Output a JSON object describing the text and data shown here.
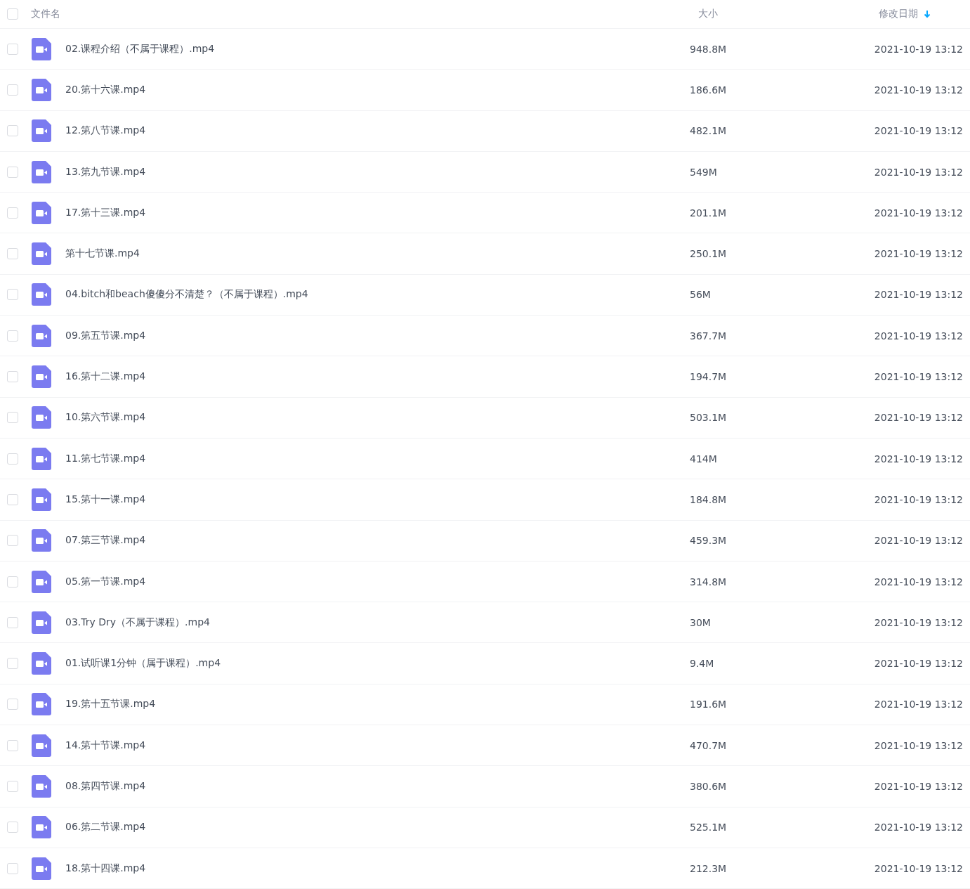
{
  "header": {
    "checked": false,
    "columns": [
      {
        "label": "文件名",
        "sorted": false
      },
      {
        "label": "大小",
        "sorted": false
      },
      {
        "label": "修改日期",
        "sorted": true
      }
    ]
  },
  "rows": [
    {
      "kind": "video",
      "checked": false,
      "name": "02.课程介绍（不属于课程）.mp4",
      "size": "948.8M",
      "modified": "2021-10-19 13:12"
    },
    {
      "kind": "video",
      "checked": false,
      "name": "20.第十六课.mp4",
      "size": "186.6M",
      "modified": "2021-10-19 13:12"
    },
    {
      "kind": "video",
      "checked": false,
      "name": "12.第八节课.mp4",
      "size": "482.1M",
      "modified": "2021-10-19 13:12"
    },
    {
      "kind": "video",
      "checked": false,
      "name": "13.第九节课.mp4",
      "size": "549M",
      "modified": "2021-10-19 13:12"
    },
    {
      "kind": "video",
      "checked": false,
      "name": "17.第十三课.mp4",
      "size": "201.1M",
      "modified": "2021-10-19 13:12"
    },
    {
      "kind": "video",
      "checked": false,
      "name": "第十七节课.mp4",
      "size": "250.1M",
      "modified": "2021-10-19 13:12"
    },
    {
      "kind": "video",
      "checked": false,
      "name": "04.bitch和beach傻傻分不清楚？（不属于课程）.mp4",
      "size": "56M",
      "modified": "2021-10-19 13:12"
    },
    {
      "kind": "video",
      "checked": false,
      "name": "09.第五节课.mp4",
      "size": "367.7M",
      "modified": "2021-10-19 13:12"
    },
    {
      "kind": "video",
      "checked": false,
      "name": "16.第十二课.mp4",
      "size": "194.7M",
      "modified": "2021-10-19 13:12"
    },
    {
      "kind": "video",
      "checked": false,
      "name": "10.第六节课.mp4",
      "size": "503.1M",
      "modified": "2021-10-19 13:12"
    },
    {
      "kind": "video",
      "checked": false,
      "name": "11.第七节课.mp4",
      "size": "414M",
      "modified": "2021-10-19 13:12"
    },
    {
      "kind": "video",
      "checked": false,
      "name": "15.第十一课.mp4",
      "size": "184.8M",
      "modified": "2021-10-19 13:12"
    },
    {
      "kind": "video",
      "checked": false,
      "name": "07.第三节课.mp4",
      "size": "459.3M",
      "modified": "2021-10-19 13:12"
    },
    {
      "kind": "video",
      "checked": false,
      "name": "05.第一节课.mp4",
      "size": "314.8M",
      "modified": "2021-10-19 13:12"
    },
    {
      "kind": "video",
      "checked": false,
      "name": "03.Try Dry（不属于课程）.mp4",
      "size": "30M",
      "modified": "2021-10-19 13:12"
    },
    {
      "kind": "video",
      "checked": false,
      "name": "01.试听课1分钟（属于课程）.mp4",
      "size": "9.4M",
      "modified": "2021-10-19 13:12"
    },
    {
      "kind": "video",
      "checked": false,
      "name": "19.第十五节课.mp4",
      "size": "191.6M",
      "modified": "2021-10-19 13:12"
    },
    {
      "kind": "video",
      "checked": false,
      "name": "14.第十节课.mp4",
      "size": "470.7M",
      "modified": "2021-10-19 13:12"
    },
    {
      "kind": "video",
      "checked": false,
      "name": "08.第四节课.mp4",
      "size": "380.6M",
      "modified": "2021-10-19 13:12"
    },
    {
      "kind": "video",
      "checked": false,
      "name": "06.第二节课.mp4",
      "size": "525.1M",
      "modified": "2021-10-19 13:12"
    },
    {
      "kind": "video",
      "checked": false,
      "name": "18.第十四课.mp4",
      "size": "212.3M",
      "modified": "2021-10-19 13:12"
    }
  ]
}
